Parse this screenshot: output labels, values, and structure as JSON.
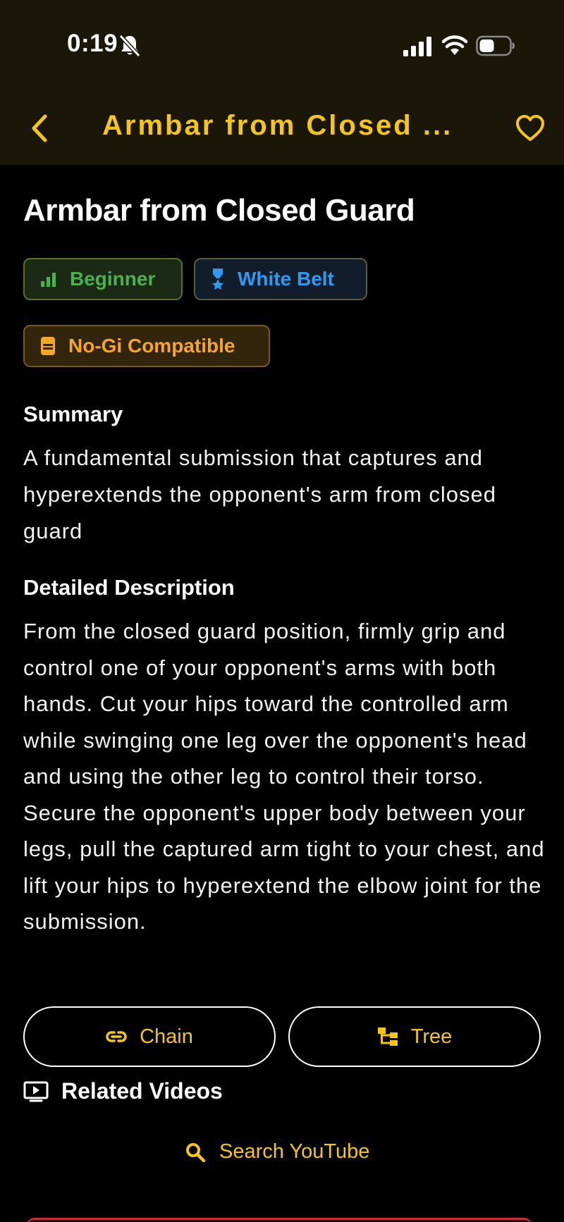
{
  "status_bar": {
    "time": "0:19"
  },
  "nav": {
    "title": "Armbar from Closed ..."
  },
  "technique": {
    "title": "Armbar from Closed Guard",
    "badges": {
      "level": "Beginner",
      "belt": "White Belt",
      "gi": "No-Gi Compatible"
    },
    "summary_heading": "Summary",
    "summary": "A fundamental submission that captures and hyperextends the opponent's arm from closed guard",
    "detail_heading": "Detailed Description",
    "detail": "From the closed guard position, firmly grip and control one of your opponent's arms with both hands. Cut your hips toward the controlled arm while swinging one leg over the opponent's head and using the other leg to control their torso. Secure the opponent's upper body between your legs, pull the captured arm tight to your chest, and lift your hips to hyperextend the elbow joint for the submission."
  },
  "actions": {
    "chain": "Chain",
    "tree": "Tree"
  },
  "related": {
    "title": "Related Videos",
    "search": "Search YouTube"
  },
  "colors": {
    "accent": "#f5c518",
    "level": "#4caf50",
    "belt": "#2f9bf0",
    "gi": "#f5a623",
    "header_bg": "#1a1608"
  },
  "icons": [
    "bell-slash-icon",
    "signal-icon",
    "wifi-icon",
    "battery-icon",
    "chevron-left-icon",
    "heart-icon",
    "bar-chart-icon",
    "medal-icon",
    "gi-icon",
    "link-icon",
    "hierarchy-icon",
    "video-icon",
    "search-icon"
  ]
}
